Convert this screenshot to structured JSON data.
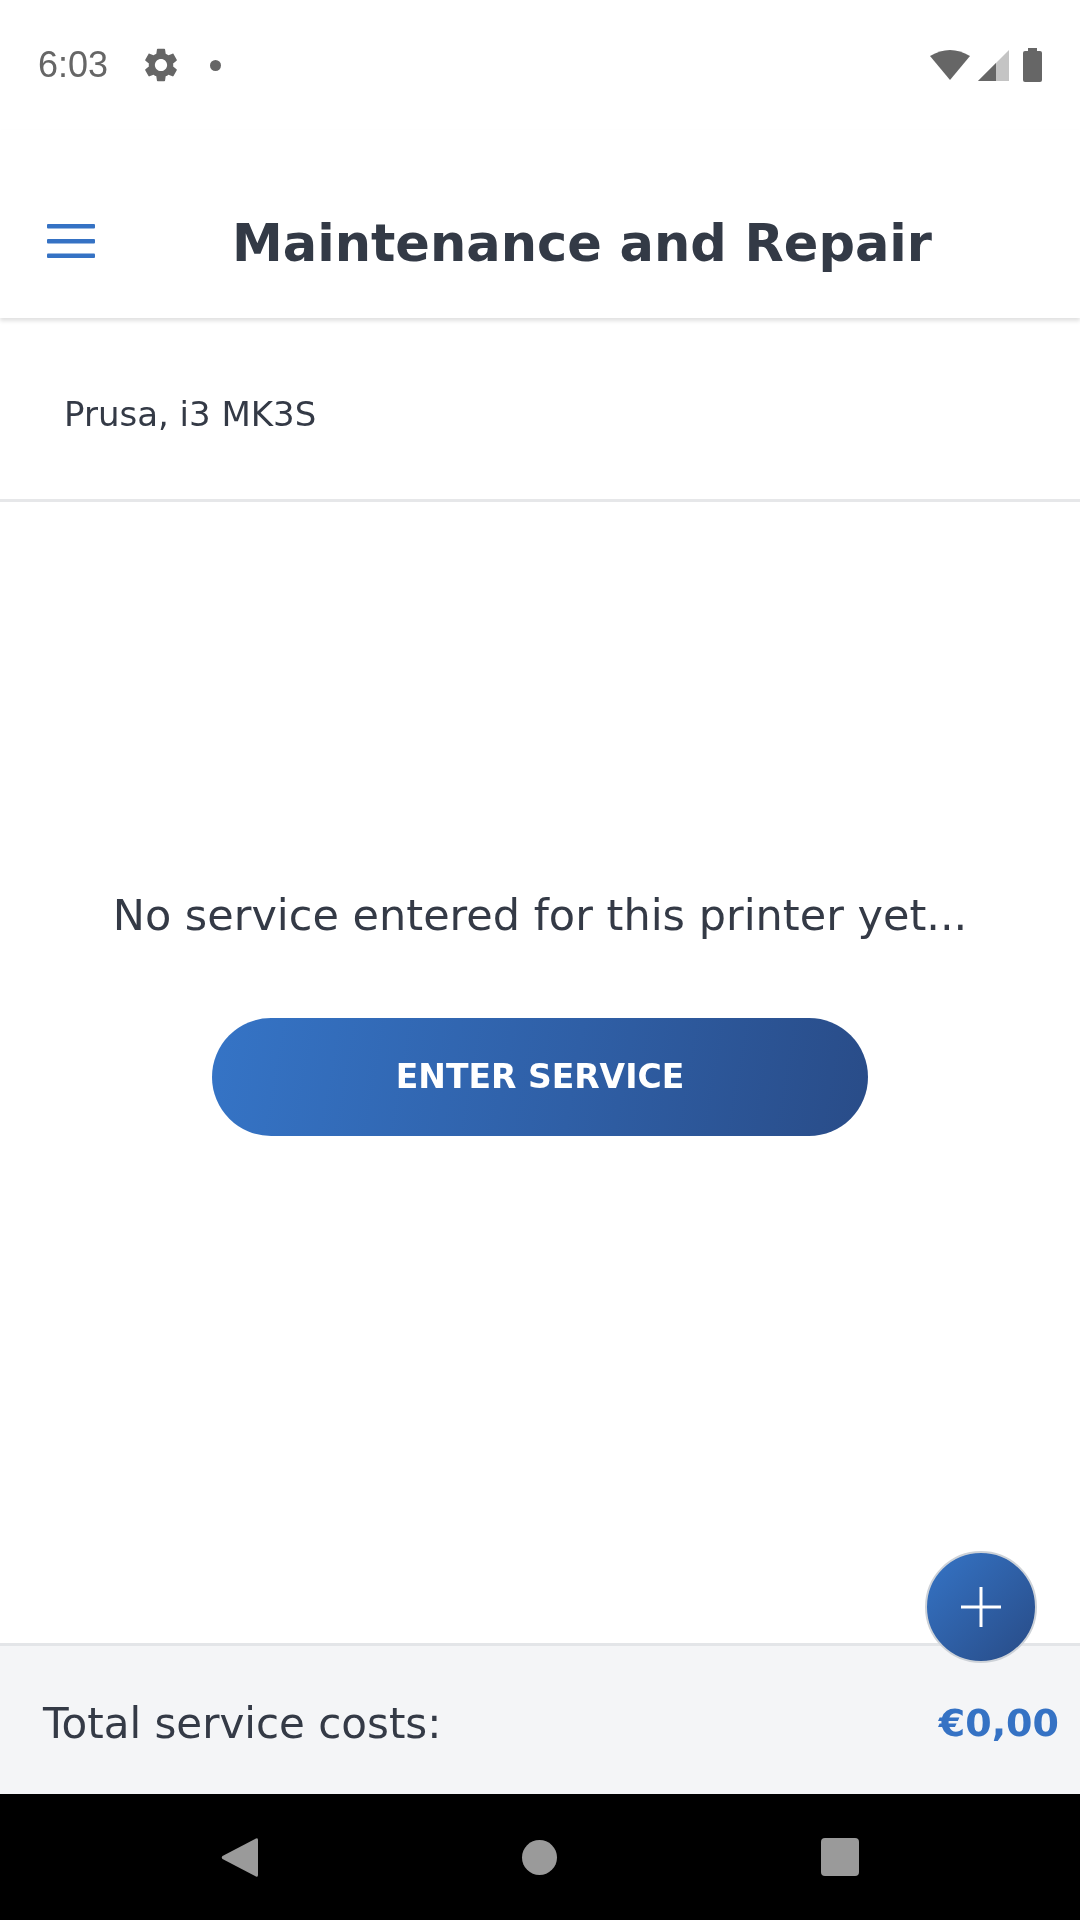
{
  "status_bar": {
    "time": "6:03"
  },
  "app_bar": {
    "title": "Maintenance and Repair"
  },
  "printer": {
    "name": "Prusa, i3 MK3S"
  },
  "empty_state": {
    "message": "No service entered for this printer yet...",
    "button": "ENTER SERVICE"
  },
  "footer": {
    "label": "Total service costs:",
    "amount": "€0,00"
  }
}
